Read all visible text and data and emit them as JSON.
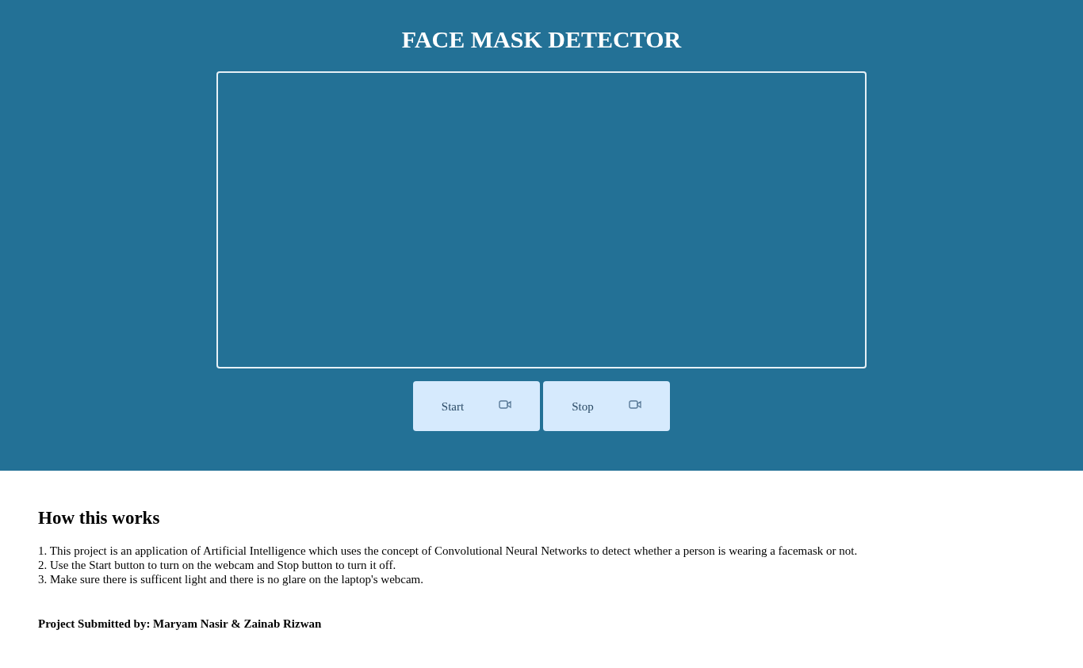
{
  "header": {
    "title": "FACE MASK DETECTOR"
  },
  "buttons": [
    {
      "label": "Start"
    },
    {
      "label": "Stop"
    }
  ],
  "info": {
    "heading": "How this works",
    "lines": [
      "1. This project is an application of Artificial Intelligence which uses the concept of Convolutional Neural Networks to detect whether a person is wearing a facemask or not.",
      "2. Use the Start button to turn on the webcam and Stop button to turn it off.",
      "3. Make sure there is sufficent light and there is no glare on the laptop's webcam."
    ],
    "credit": "Project Submitted by: Maryam Nasir & Zainab Rizwan"
  }
}
